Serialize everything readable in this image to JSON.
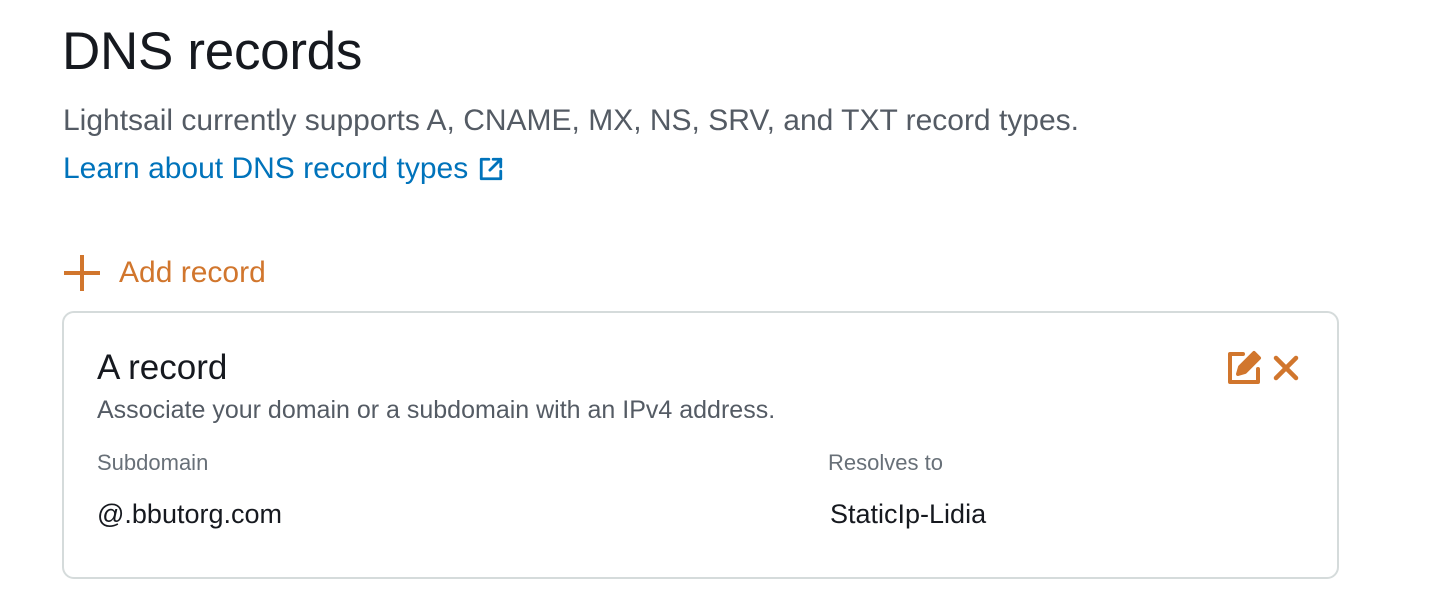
{
  "header": {
    "title": "DNS records",
    "description": "Lightsail currently supports A, CNAME, MX, NS, SRV, and TXT record types.",
    "learn_link": "Learn about DNS record types",
    "learn_link_icon": "external-link-icon"
  },
  "actions": {
    "add_record_label": "Add record",
    "add_record_icon": "plus-icon"
  },
  "records": [
    {
      "type": "A record",
      "description": "Associate your domain or a subdomain with an IPv4 address.",
      "subdomain_label": "Subdomain",
      "subdomain_value": "@.bbutorg.com",
      "resolves_label": "Resolves to",
      "resolves_value": "StaticIp-Lidia",
      "edit_icon": "edit-icon",
      "delete_icon": "close-icon"
    }
  ],
  "colors": {
    "accent": "#d1762d",
    "link": "#0073bb",
    "text": "#16191f",
    "muted": "#545b64",
    "border": "#d5dbdb"
  }
}
